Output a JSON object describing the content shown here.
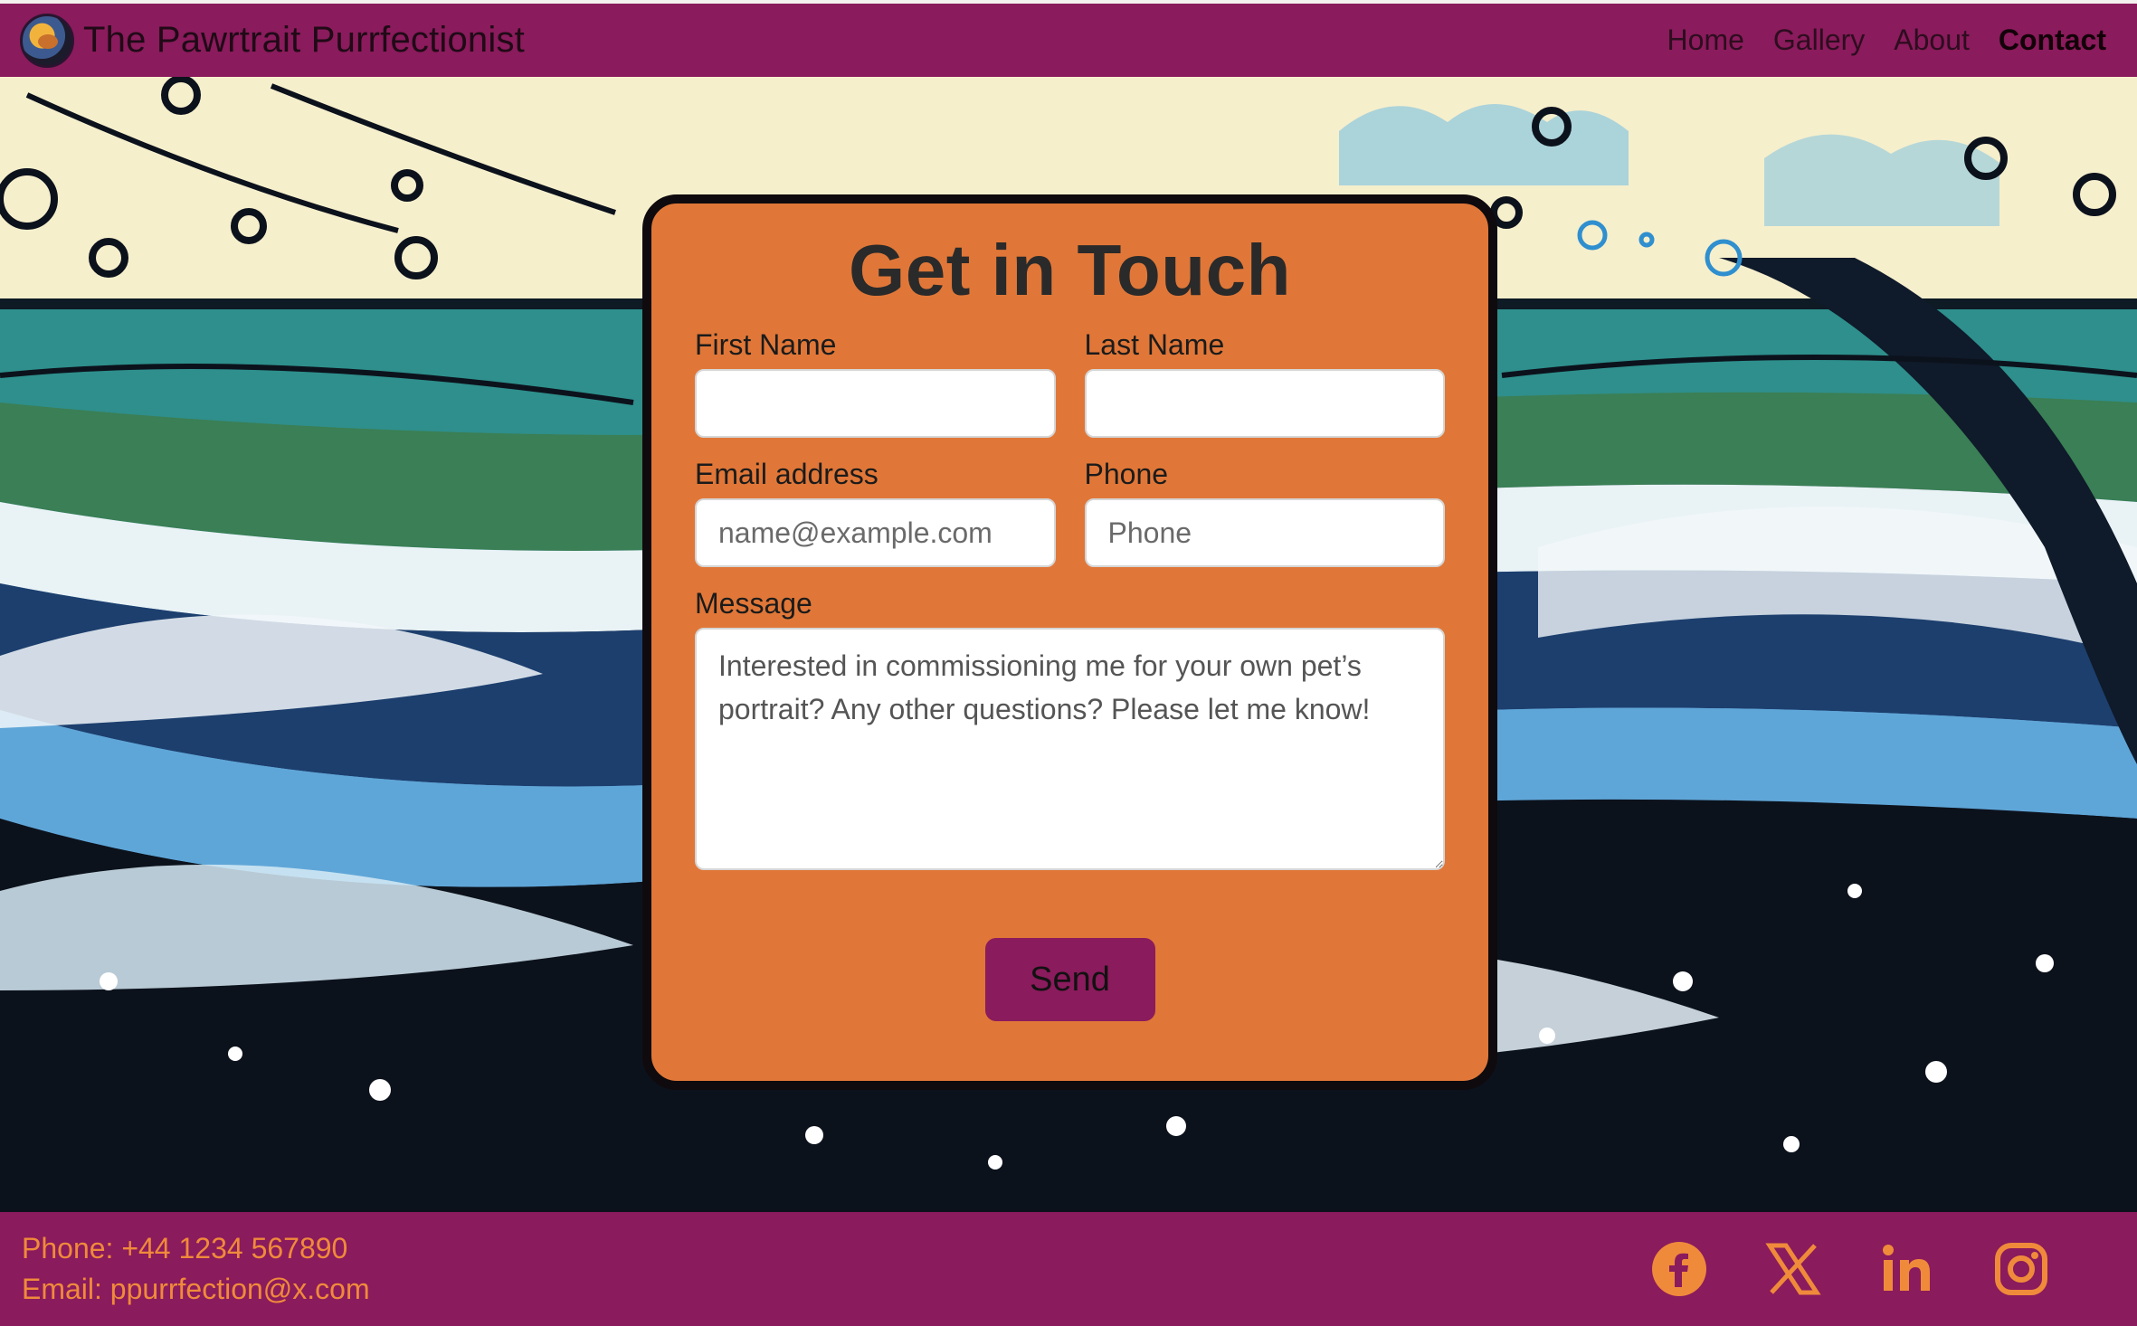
{
  "brand": {
    "title": "The Pawrtrait Purrfectionist"
  },
  "nav": {
    "items": [
      "Home",
      "Gallery",
      "About",
      "Contact"
    ],
    "active": "Contact"
  },
  "form": {
    "title": "Get in Touch",
    "first_name_label": "First Name",
    "last_name_label": "Last Name",
    "email_label": "Email address",
    "email_placeholder": "name@example.com",
    "phone_label": "Phone",
    "phone_placeholder": "Phone",
    "message_label": "Message",
    "message_placeholder": "Interested in commissioning me for your own pet’s portrait? Any other questions? Please let me know!",
    "send_label": "Send"
  },
  "footer": {
    "phone": "Phone: +44 1234 567890",
    "email": "Email: ppurrfection@x.com",
    "socials": [
      "facebook-icon",
      "x-icon",
      "linkedin-icon",
      "instagram-icon"
    ]
  },
  "colors": {
    "nav_bg": "#8a1b5c",
    "card_bg": "#e07738",
    "footer_text": "#f08a3b",
    "button": "#8a1b5c"
  }
}
